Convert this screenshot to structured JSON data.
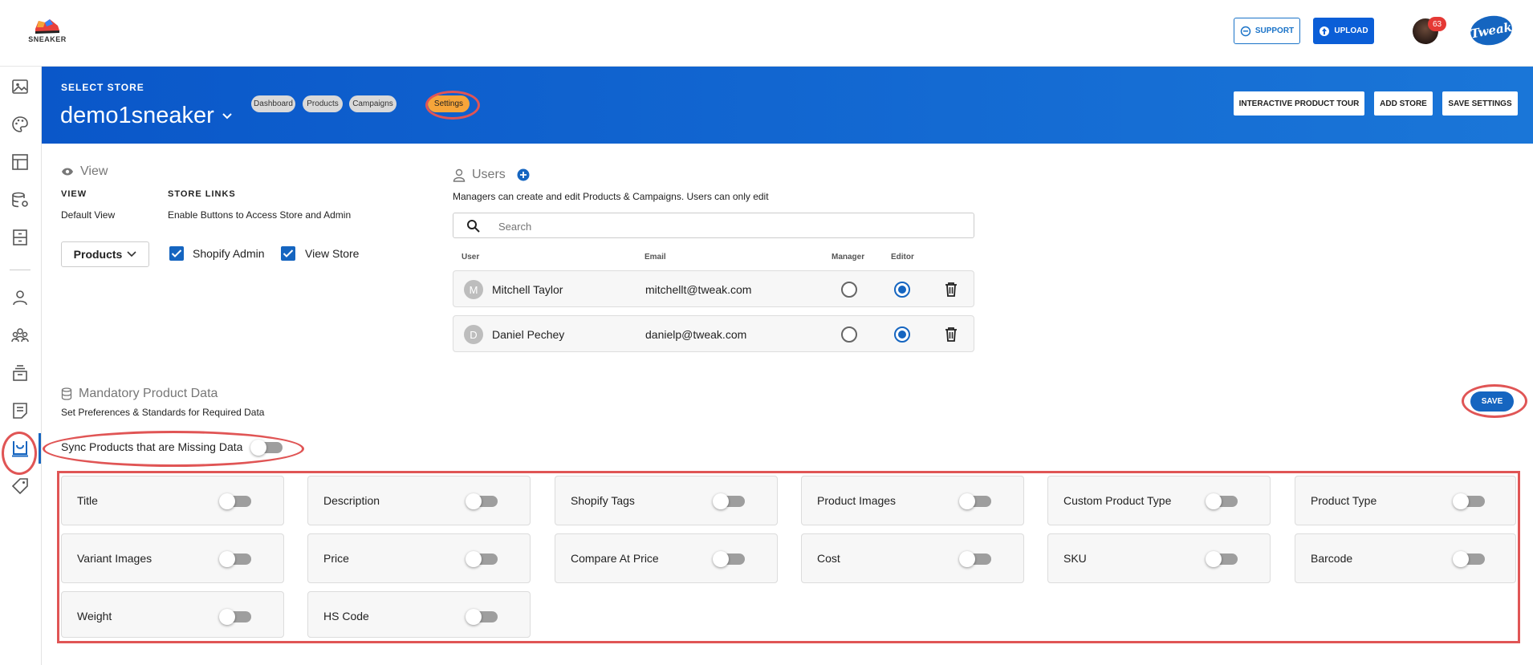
{
  "topbar": {
    "logo_text": "SNEAKER",
    "support_label": "SUPPORT",
    "upload_label": "UPLOAD",
    "notification_count": "63",
    "brand_logo_text": "Tweak"
  },
  "sidebar": {
    "items": [
      "image-icon",
      "palette-icon",
      "layout-icon",
      "database-settings-icon",
      "archive-icon",
      "user-icon",
      "users-group-icon",
      "store-stack-icon",
      "notes-icon",
      "storefront-icon",
      "tag-icon"
    ],
    "active_item": "storefront-icon"
  },
  "header": {
    "select_store_label": "SELECT STORE",
    "store_name": "demo1sneaker",
    "tabs": [
      {
        "label": "Dashboard"
      },
      {
        "label": "Products"
      },
      {
        "label": "Campaigns"
      },
      {
        "label": "Settings",
        "active": true
      }
    ],
    "buttons": {
      "tour": "INTERACTIVE PRODUCT TOUR",
      "add_store": "ADD STORE",
      "save_settings": "SAVE SETTINGS"
    }
  },
  "view_section": {
    "title": "View",
    "view_label": "VIEW",
    "default_view_text": "Default View",
    "default_view_value": "Products",
    "store_links_label": "STORE LINKS",
    "store_links_text": "Enable Buttons to Access Store and Admin",
    "links": [
      {
        "label": "Shopify Admin",
        "checked": true
      },
      {
        "label": "View Store",
        "checked": true
      }
    ]
  },
  "users_section": {
    "title": "Users",
    "description": "Managers can create and edit Products & Campaigns. Users can only edit",
    "search_placeholder": "Search",
    "columns": {
      "user": "User",
      "email": "Email",
      "manager": "Manager",
      "editor": "Editor"
    },
    "rows": [
      {
        "initial": "M",
        "name": "Mitchell Taylor",
        "email": "mitchellt@tweak.com",
        "manager": false,
        "editor": true
      },
      {
        "initial": "D",
        "name": "Daniel Pechey",
        "email": "danielp@tweak.com",
        "manager": false,
        "editor": true
      }
    ]
  },
  "mandatory_section": {
    "title": "Mandatory Product Data",
    "subtitle": "Set Preferences & Standards for Required Data",
    "save_label": "SAVE",
    "sync_label": "Sync Products that are Missing Data",
    "sync_enabled": false,
    "fields": [
      {
        "label": "Title",
        "enabled": false
      },
      {
        "label": "Description",
        "enabled": false
      },
      {
        "label": "Shopify Tags",
        "enabled": false
      },
      {
        "label": "Product Images",
        "enabled": false
      },
      {
        "label": "Custom Product Type",
        "enabled": false
      },
      {
        "label": "Product Type",
        "enabled": false
      },
      {
        "label": "Variant Images",
        "enabled": false
      },
      {
        "label": "Price",
        "enabled": false
      },
      {
        "label": "Compare At Price",
        "enabled": false
      },
      {
        "label": "Cost",
        "enabled": false
      },
      {
        "label": "SKU",
        "enabled": false
      },
      {
        "label": "Barcode",
        "enabled": false
      },
      {
        "label": "Weight",
        "enabled": false
      },
      {
        "label": "HS Code",
        "enabled": false
      }
    ]
  },
  "colors": {
    "primary": "#1565c0",
    "header_gradient_start": "#0a57c9",
    "header_gradient_end": "#1a76d8",
    "active_tab": "#f6a53a",
    "annotation": "#e05555",
    "badge": "#e53935"
  }
}
